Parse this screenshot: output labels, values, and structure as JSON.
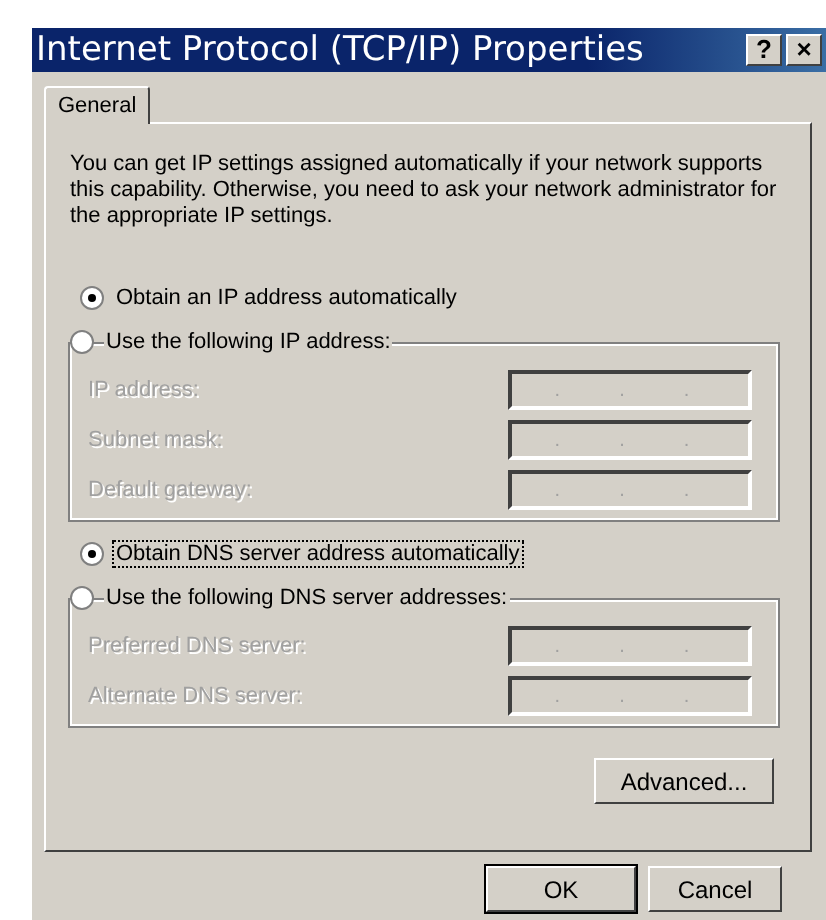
{
  "window": {
    "title": "Internet Protocol (TCP/IP) Properties",
    "help_button": "?",
    "close_button": "×"
  },
  "tabs": [
    {
      "label": "General",
      "selected": true
    }
  ],
  "description": "You can get IP settings assigned automatically if your network supports this capability. Otherwise, you need to ask your network administrator for the appropriate IP settings.",
  "ip_options": [
    {
      "label": "Obtain an IP address automatically",
      "selected": true,
      "focused": false
    },
    {
      "label": "Use the following IP address:",
      "selected": false,
      "focused": false
    }
  ],
  "ip_fields": [
    {
      "label": "IP address:",
      "value": ".  .  .",
      "disabled": true
    },
    {
      "label": "Subnet mask:",
      "value": ".  .  .",
      "disabled": true
    },
    {
      "label": "Default gateway:",
      "value": ".  .  .",
      "disabled": true
    }
  ],
  "dns_options": [
    {
      "label": "Obtain DNS server address automatically",
      "selected": true,
      "focused": true
    },
    {
      "label": "Use the following DNS server addresses:",
      "selected": false,
      "focused": false
    }
  ],
  "dns_fields": [
    {
      "label": "Preferred DNS server:",
      "value": ".  .  .",
      "disabled": true
    },
    {
      "label": "Alternate DNS server:",
      "value": ".  .  .",
      "disabled": true
    }
  ],
  "advanced_button": "Advanced...",
  "buttons": [
    {
      "label": "OK",
      "default": true
    },
    {
      "label": "Cancel",
      "default": false
    }
  ]
}
